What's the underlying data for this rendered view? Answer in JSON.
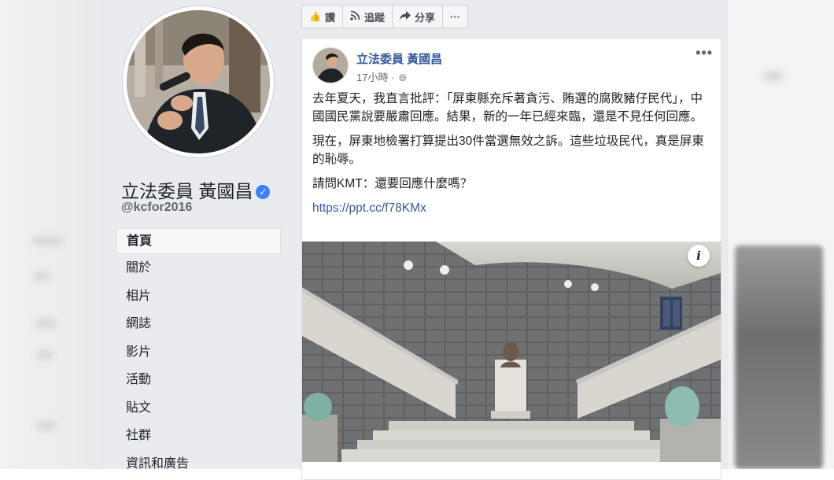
{
  "sidebar": {
    "page_name": "立法委員 黃國昌",
    "handle": "@kcfor2016",
    "verified_icon": "check-icon",
    "nav": [
      {
        "label": "首頁",
        "active": true
      },
      {
        "label": "關於"
      },
      {
        "label": "相片"
      },
      {
        "label": "網誌"
      },
      {
        "label": "影片"
      },
      {
        "label": "活動"
      },
      {
        "label": "貼文"
      },
      {
        "label": "社群"
      },
      {
        "label": "資訊和廣告"
      }
    ]
  },
  "actionbar": {
    "like": {
      "label": "讚",
      "icon": "thumbs-up-icon"
    },
    "follow": {
      "label": "追蹤",
      "icon": "rss-icon"
    },
    "share": {
      "label": "分享",
      "icon": "share-arrow-icon"
    },
    "more": {
      "label": "···",
      "icon": "more-icon"
    }
  },
  "post": {
    "author": "立法委員 黃國昌",
    "time": "17小時 ·",
    "more": "•••",
    "paragraphs": [
      "去年夏天，我直言批評：「屏東縣充斥著貪污、賄選的腐敗豬仔民代」，中國國民黨說要嚴肅回應。結果，新的一年已經來臨，還是不見任何回應。",
      "現在，屏東地檢署打算提出30件當選無效之訴。這些垃圾民代，真是屏東的恥辱。",
      "請問KMT：還要回應什麼嗎？"
    ],
    "link": "https://ppt.cc/f78KMx",
    "info_label": "i"
  },
  "colors": {
    "link": "#385898",
    "verified": "#4080ff",
    "background": "#e9ebee"
  }
}
